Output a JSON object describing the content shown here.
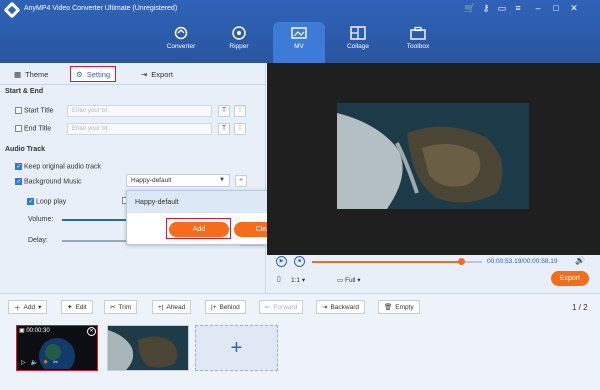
{
  "app": {
    "title": "AnyMP4 Video Converter Ultimate (Unregistered)"
  },
  "nav": [
    {
      "label": "Converter",
      "icon": "converter-icon"
    },
    {
      "label": "Ripper",
      "icon": "ripper-icon"
    },
    {
      "label": "MV",
      "icon": "mv-icon",
      "active": true
    },
    {
      "label": "Collage",
      "icon": "collage-icon"
    },
    {
      "label": "Toolbox",
      "icon": "toolbox-icon"
    }
  ],
  "subtabs": {
    "theme": "Theme",
    "setting": "Setting",
    "export": "Export"
  },
  "start_end": {
    "header": "Start & End",
    "start_label": "Start Title",
    "end_label": "End Title",
    "placeholder": "Enter your txt"
  },
  "audio": {
    "header": "Audio Track",
    "keep_original": "Keep original audio track",
    "background_music": "Background Music",
    "music_value": "Happy-default",
    "loop_play": "Loop play",
    "volume": "Volume:",
    "delay": "Delay:"
  },
  "popup": {
    "item": "Happy-default",
    "add": "Add",
    "clear": "Clear"
  },
  "player": {
    "time": "00:00:53.19/00:00:58.19",
    "ratio": "1:1",
    "mode": "Full",
    "export": "Export"
  },
  "toolbar": {
    "add": "Add",
    "edit": "Edit",
    "trim": "Trim",
    "ahead": "Ahead",
    "behind": "Behind",
    "forward": "Forward",
    "backward": "Backward",
    "empty": "Empty",
    "page": "1 / 2"
  },
  "thumb": {
    "duration": "00:00:30"
  },
  "colors": {
    "accent": "#2f63b8",
    "orange": "#f56d1a",
    "highlight": "#e0182b"
  }
}
